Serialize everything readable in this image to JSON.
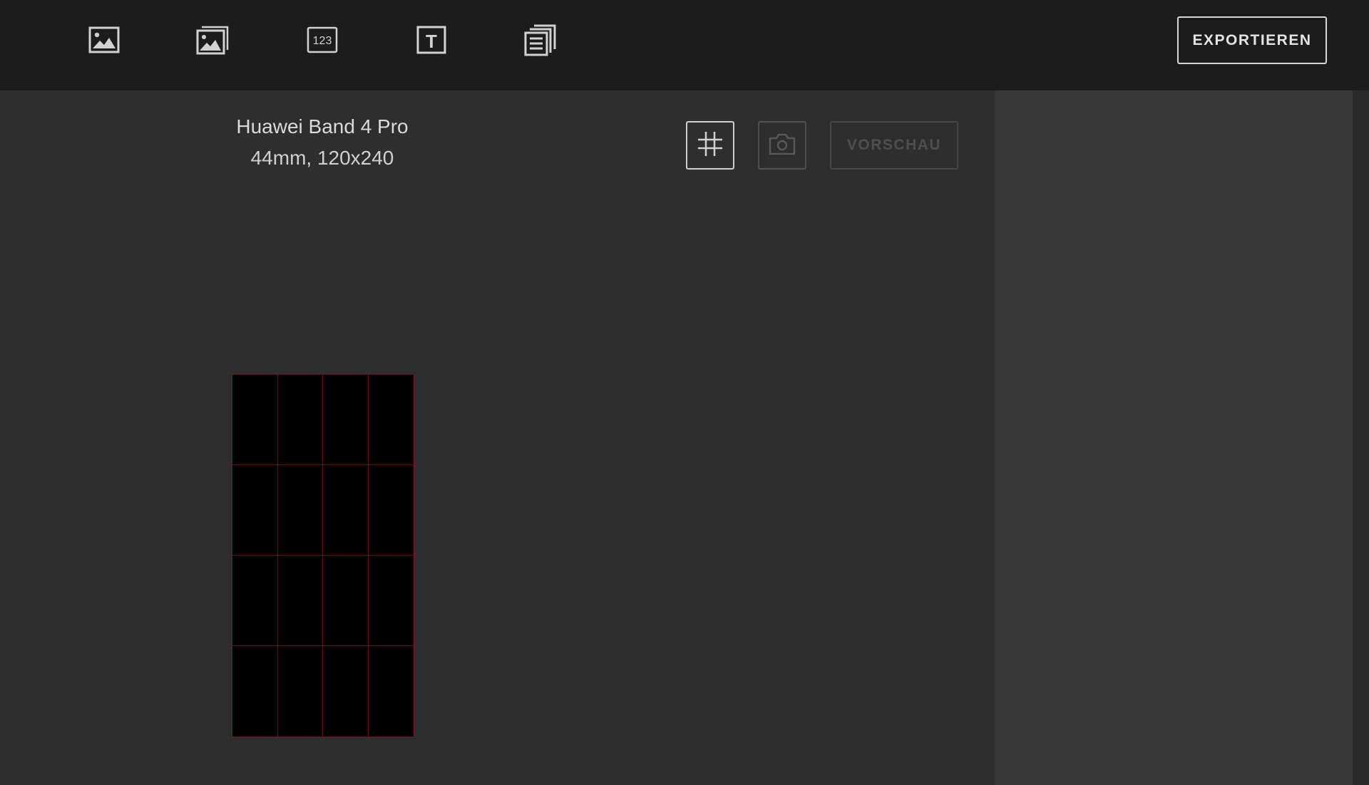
{
  "toolbar": {
    "tools": [
      {
        "icon": "image-icon",
        "label": "Bild"
      },
      {
        "icon": "image-stack-icon",
        "label": "Bildfolge"
      },
      {
        "icon": "number-icon",
        "label": "Zahl",
        "glyph": "123"
      },
      {
        "icon": "text-icon",
        "label": "Text",
        "glyph": "T"
      },
      {
        "icon": "copy-documents-icon",
        "label": "Dokumente"
      }
    ],
    "export_label": "EXPORTIEREN"
  },
  "device": {
    "name": "Huawei Band 4 Pro",
    "spec": "44mm, 120x240"
  },
  "canvas_controls": {
    "grid_icon": "grid-icon",
    "camera_icon": "camera-icon",
    "preview_label": "VORSCHAU"
  },
  "canvas": {
    "grid_columns": 4,
    "grid_rows": 4,
    "background": "#000000",
    "grid_line_color": "#5a1414"
  },
  "colors": {
    "topbar": "#1c1c1c",
    "workspace": "#2e2e2e",
    "right_panel": "#383838",
    "accent_text": "#e3e3e3"
  }
}
